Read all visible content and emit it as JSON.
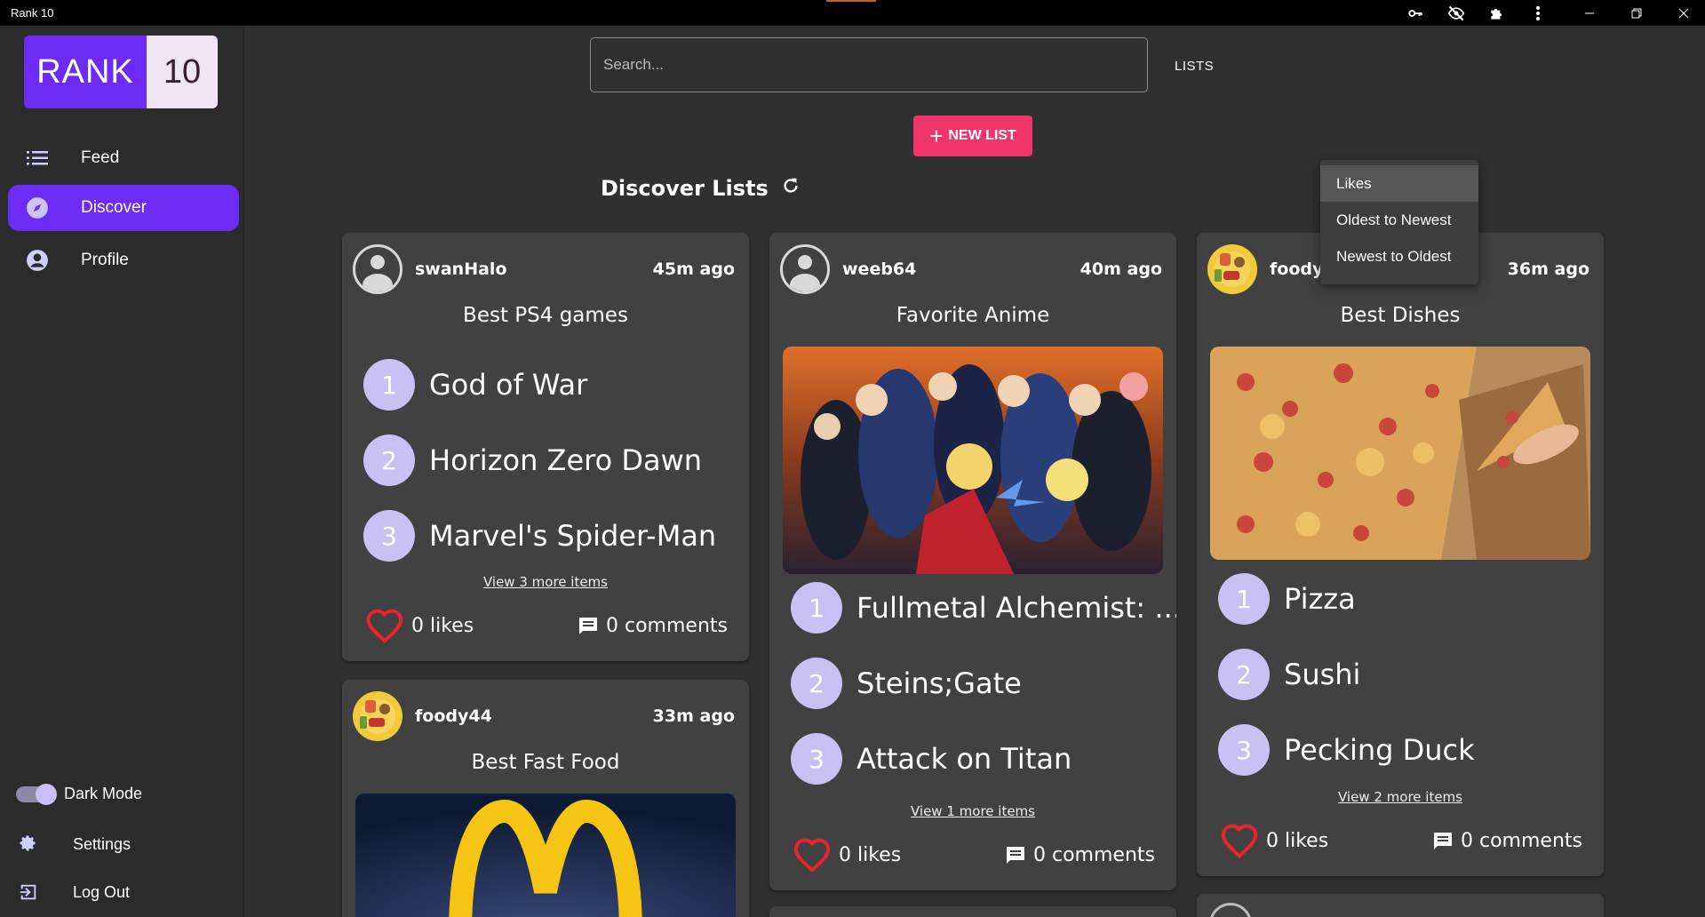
{
  "window": {
    "title": "Rank 10"
  },
  "logo": {
    "part1": "RANK",
    "part2": "10"
  },
  "sidebar": {
    "items": [
      {
        "label": "Feed",
        "icon": "list-icon"
      },
      {
        "label": "Discover",
        "icon": "compass-icon",
        "active": true
      },
      {
        "label": "Profile",
        "icon": "account-icon"
      }
    ],
    "dark_mode_label": "Dark Mode",
    "dark_mode_on": true,
    "settings_label": "Settings",
    "logout_label": "Log Out"
  },
  "search": {
    "placeholder": "Search..."
  },
  "nav": {
    "lists_label": "LISTS"
  },
  "new_list": {
    "label": "NEW LIST"
  },
  "discover": {
    "title": "Discover Lists"
  },
  "sort_menu": {
    "options": [
      "Likes",
      "Oldest to Newest",
      "Newest to Oldest"
    ],
    "selected": "Likes"
  },
  "colors": {
    "accent": "#6d2cf5",
    "new_list": "#f0356b",
    "rank_badge": "#c9c0f3",
    "heart": "#e8252f"
  },
  "cards": [
    {
      "user": "swanHalo",
      "time": "45m ago",
      "title": "Best PS4 games",
      "items": [
        {
          "rank": "1",
          "label": "God of War"
        },
        {
          "rank": "2",
          "label": "Horizon Zero Dawn"
        },
        {
          "rank": "3",
          "label": "Marvel's Spider-Man"
        }
      ],
      "more": "View 3 more items",
      "likes": "0 likes",
      "comments": "0 comments"
    },
    {
      "user": "weeb64",
      "time": "40m ago",
      "title": "Favorite Anime",
      "items": [
        {
          "rank": "1",
          "label": "Fullmetal Alchemist: ..."
        },
        {
          "rank": "2",
          "label": "Steins;Gate"
        },
        {
          "rank": "3",
          "label": "Attack on Titan"
        }
      ],
      "more": "View 1 more items",
      "likes": "0 likes",
      "comments": "0 comments"
    },
    {
      "user": "foody44",
      "time": "36m ago",
      "title": "Best Dishes",
      "items": [
        {
          "rank": "1",
          "label": "Pizza"
        },
        {
          "rank": "2",
          "label": "Sushi"
        },
        {
          "rank": "3",
          "label": "Pecking Duck"
        }
      ],
      "more": "View 2 more items",
      "likes": "0 likes",
      "comments": "0 comments"
    },
    {
      "user": "foody44",
      "time": "33m ago",
      "title": "Best Fast Food"
    }
  ]
}
